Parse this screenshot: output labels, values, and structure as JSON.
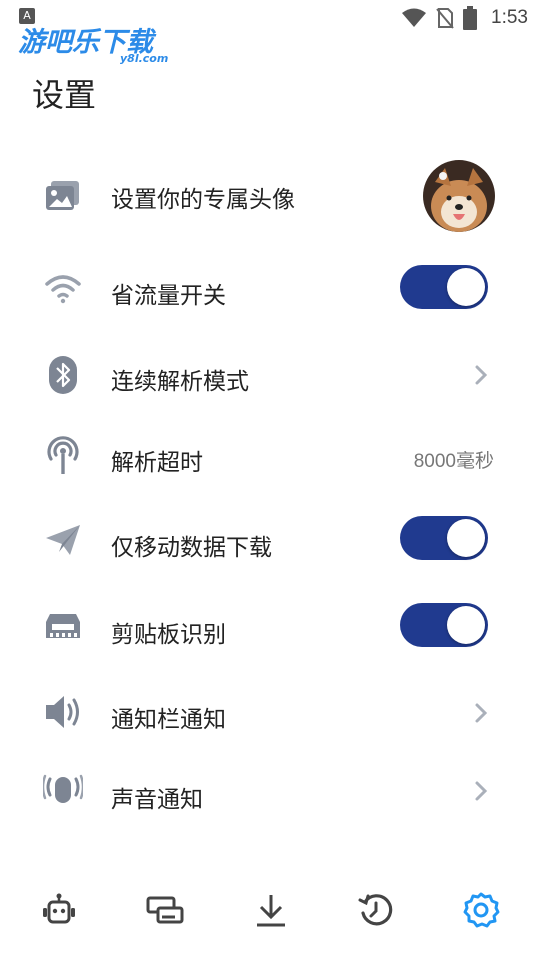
{
  "status_bar": {
    "badge": "A",
    "time": "1:53",
    "icons": [
      "wifi-icon",
      "no-sim-icon",
      "battery-icon"
    ]
  },
  "watermark": {
    "text": "游吧乐下载",
    "sub": "y8l.com"
  },
  "page": {
    "title": "设置"
  },
  "settings": {
    "avatar": {
      "label": "设置你的专属头像",
      "icon": "image-card-icon"
    },
    "data_saver": {
      "label": "省流量开关",
      "icon": "wifi-signal-icon",
      "toggle_on": true
    },
    "continuous_parse": {
      "label": "连续解析模式",
      "icon": "bluetooth-icon"
    },
    "parse_timeout": {
      "label": "解析超时",
      "icon": "antenna-icon",
      "value": "8000毫秒"
    },
    "mobile_data_download": {
      "label": "仅移动数据下载",
      "icon": "paper-plane-icon",
      "toggle_on": true
    },
    "clipboard_detect": {
      "label": "剪贴板识别",
      "icon": "memory-chip-icon",
      "toggle_on": true
    },
    "notification_bar": {
      "label": "通知栏通知",
      "icon": "speaker-icon"
    },
    "sound_notification": {
      "label": "声音通知",
      "icon": "microphone-icon"
    }
  },
  "bottom_nav": {
    "items": [
      "robot-icon",
      "cards-icon",
      "download-icon",
      "history-icon",
      "settings-gear-icon"
    ],
    "active_color": "#2196f3",
    "inactive_color": "#444444"
  },
  "colors": {
    "toggle_on": "#203a8f",
    "icon_gray": "#7d8593"
  }
}
